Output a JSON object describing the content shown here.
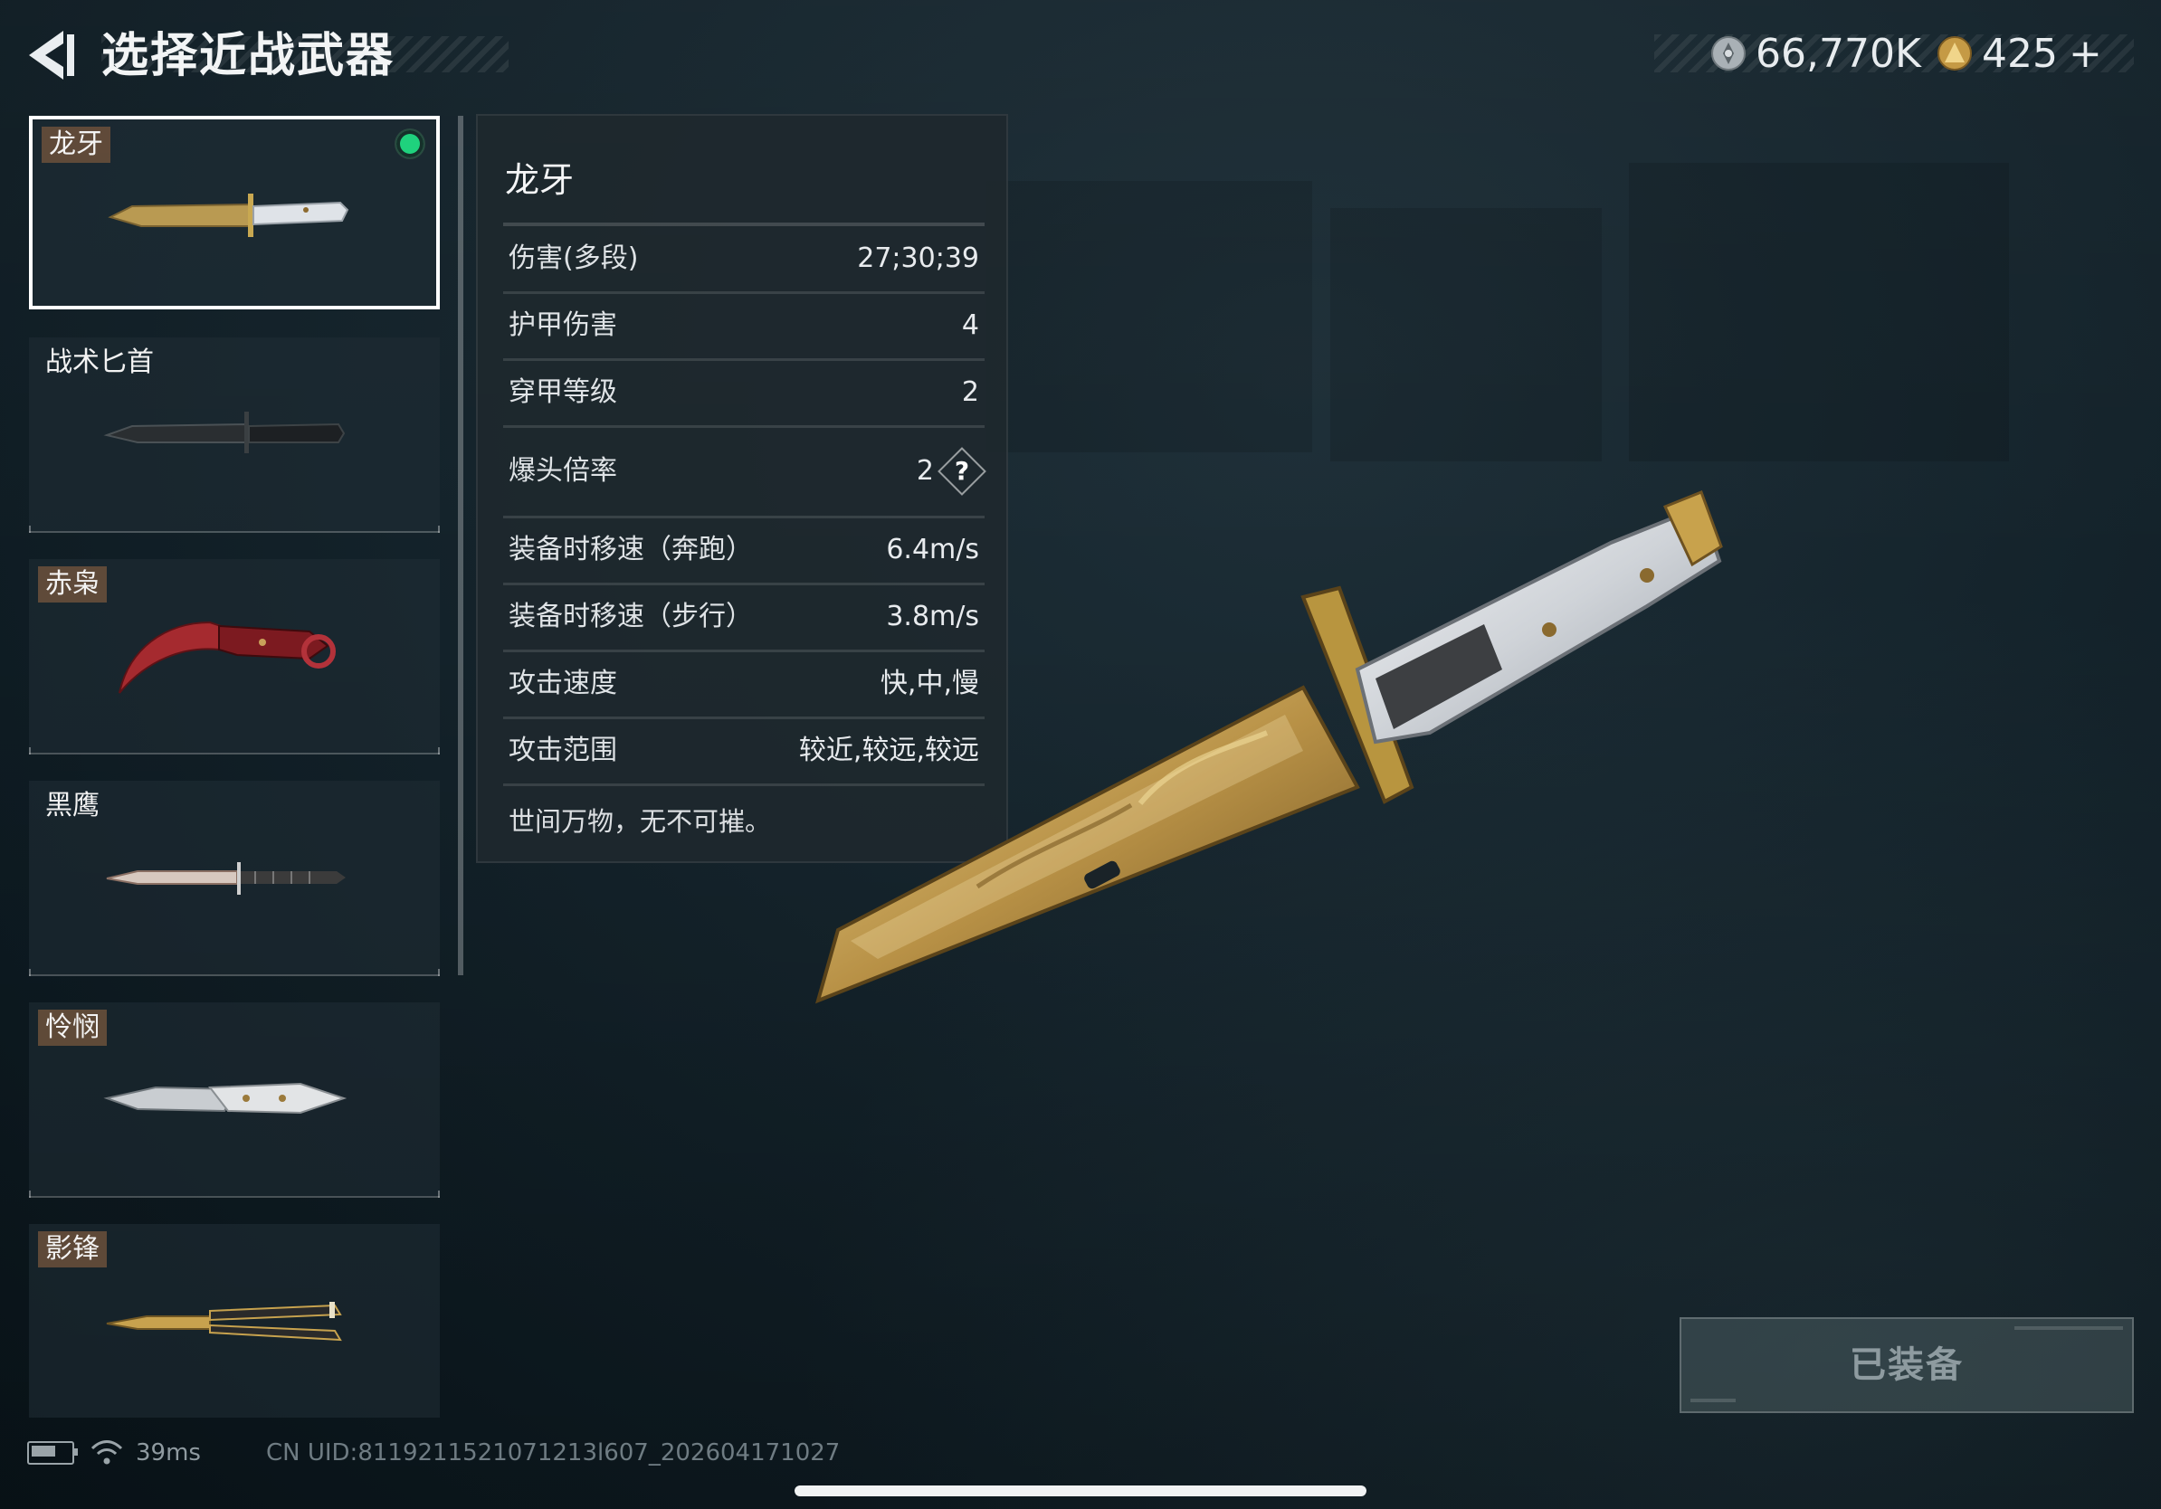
{
  "header": {
    "title": "选择近战武器",
    "back_icon": "back-arrow-icon"
  },
  "currency": {
    "silver": {
      "icon": "silver-coin-icon",
      "value": "66,770K"
    },
    "gold": {
      "icon": "gold-coin-icon",
      "value": "425",
      "add": "+"
    }
  },
  "weapons": [
    {
      "name": "龙牙",
      "tagged": true,
      "selected": true,
      "equipped": true,
      "icon": "dragon-fang-knife-icon"
    },
    {
      "name": "战术匕首",
      "tagged": false,
      "selected": false,
      "equipped": false,
      "icon": "tactical-dagger-icon"
    },
    {
      "name": "赤枭",
      "tagged": true,
      "selected": false,
      "equipped": false,
      "icon": "karambit-icon"
    },
    {
      "name": "黑鹰",
      "tagged": false,
      "selected": false,
      "equipped": false,
      "icon": "black-hawk-knife-icon"
    },
    {
      "name": "怜悯",
      "tagged": true,
      "selected": false,
      "equipped": false,
      "icon": "mercy-knife-icon"
    },
    {
      "name": "影锋",
      "tagged": true,
      "selected": false,
      "equipped": false,
      "icon": "butterfly-knife-icon"
    }
  ],
  "stats": {
    "name": "龙牙",
    "rows": [
      {
        "label": "伤害(多段)",
        "value": "27;30;39"
      },
      {
        "label": "护甲伤害",
        "value": "4"
      },
      {
        "label": "穿甲等级",
        "value": "2"
      },
      {
        "label": "爆头倍率",
        "value": "2",
        "help": "?"
      },
      {
        "label": "装备时移速（奔跑）",
        "value": "6.4m/s"
      },
      {
        "label": "装备时移速（步行）",
        "value": "3.8m/s"
      },
      {
        "label": "攻击速度",
        "value": "快,中,慢"
      },
      {
        "label": "攻击范围",
        "value": "较近,较远,较远"
      }
    ],
    "description": "世间万物，无不可摧。"
  },
  "equip_button": {
    "label": "已装备"
  },
  "footer": {
    "battery_icon": "battery-icon",
    "wifi_icon": "wifi-icon",
    "ping": "39ms",
    "uid": "CN UID:8119211521071213l607_202604171027"
  },
  "colors": {
    "background": "#14232b",
    "equipped_dot": "#1fd27d",
    "tag_bg": "#73553c",
    "panel": "#1e282e"
  }
}
